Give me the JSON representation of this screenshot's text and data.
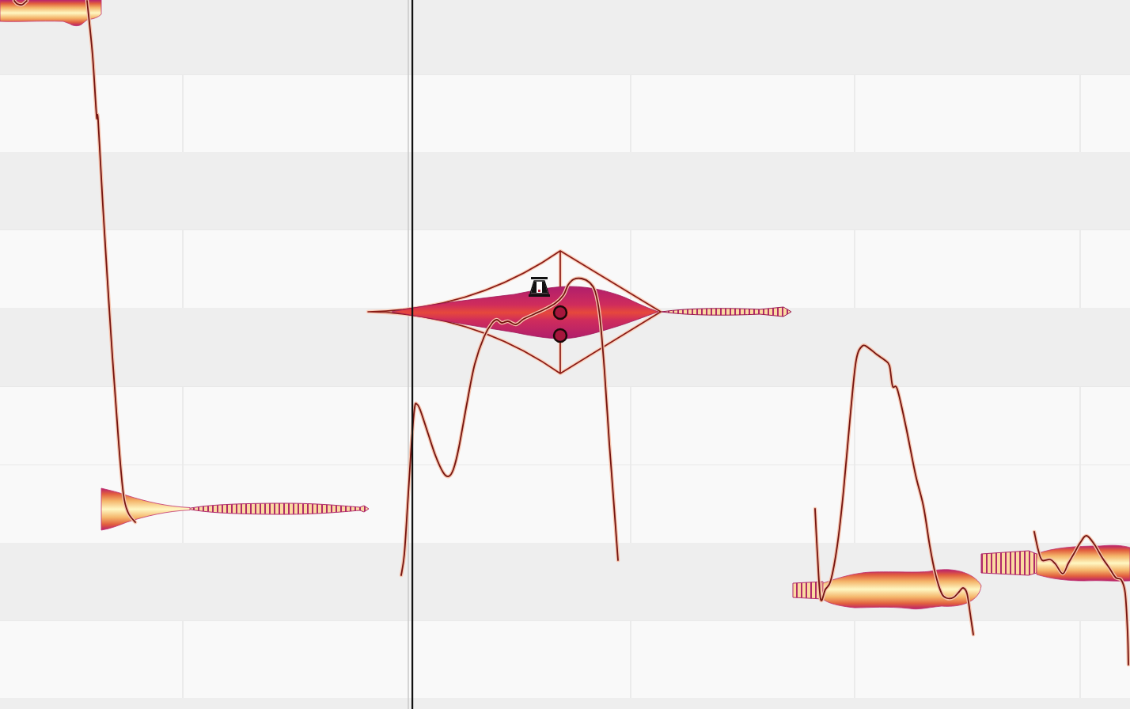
{
  "editor": {
    "notes": [
      {
        "selected": false
      },
      {
        "selected": false
      },
      {
        "selected": true
      },
      {
        "selected": false
      },
      {
        "selected": false
      }
    ]
  }
}
